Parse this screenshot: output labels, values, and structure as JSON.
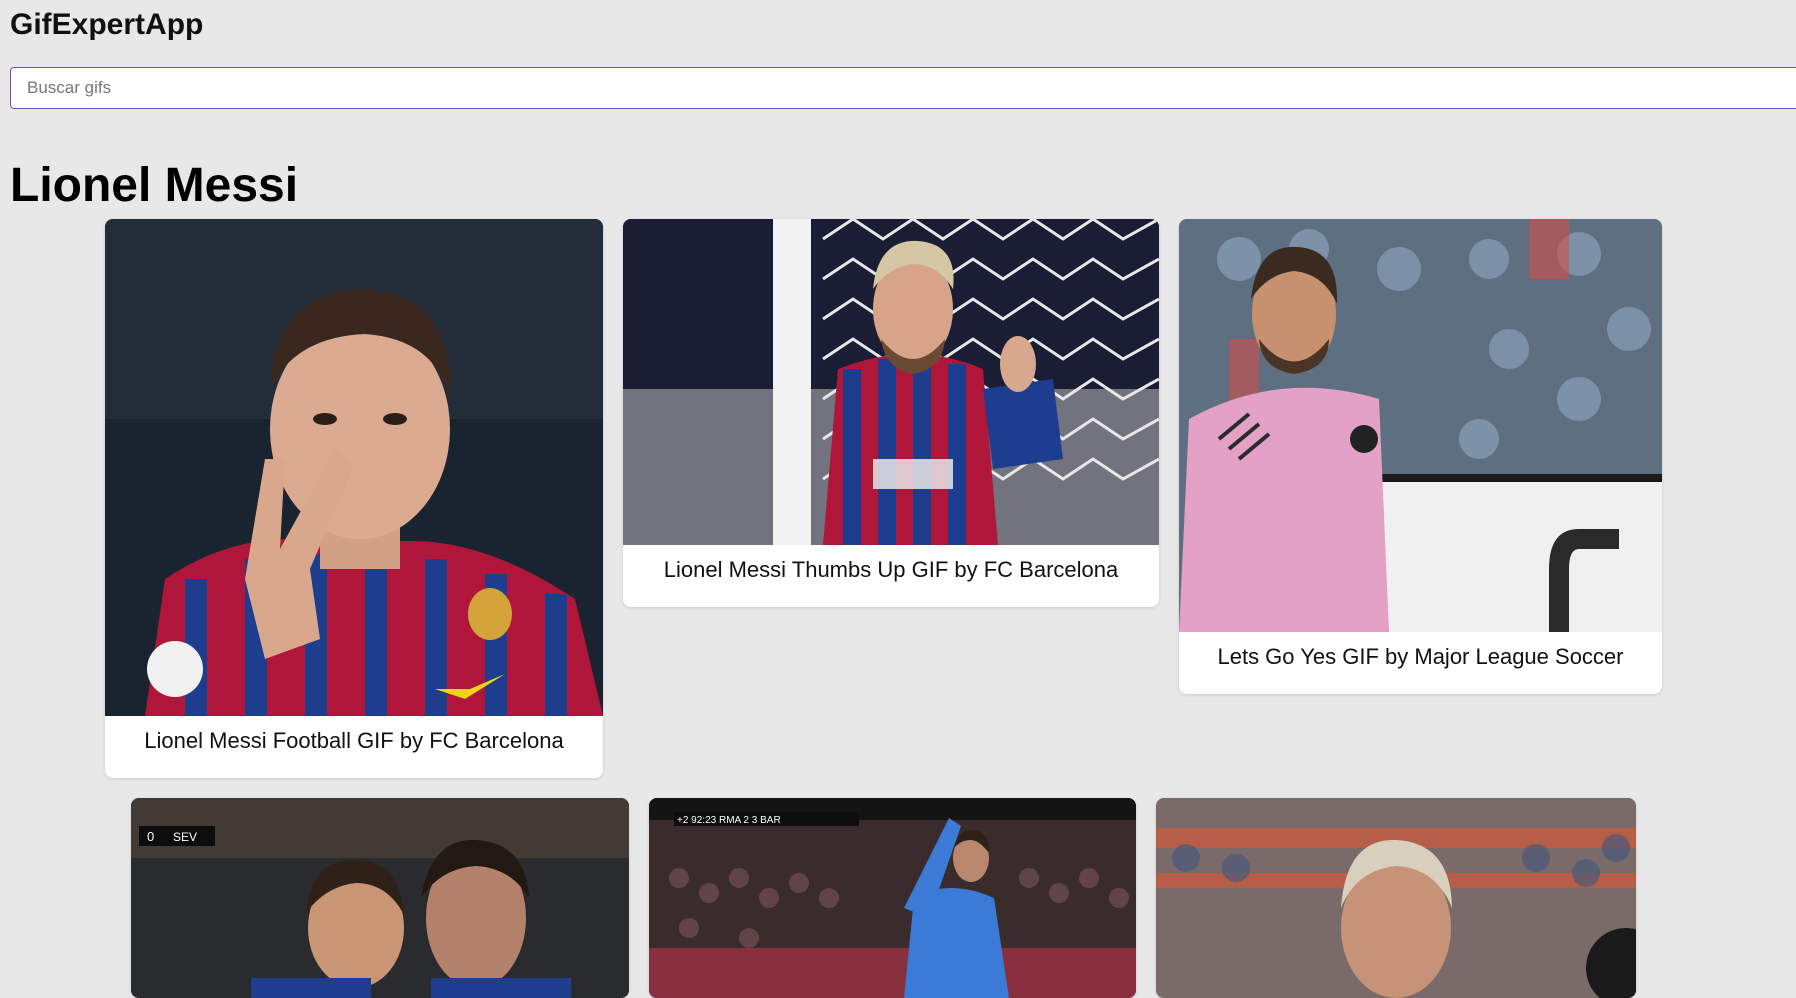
{
  "header": {
    "app_title": "GifExpertApp"
  },
  "search": {
    "placeholder": "Buscar gifs",
    "value": ""
  },
  "category": {
    "title": "Lionel Messi"
  },
  "gifs": [
    {
      "title": "Lionel Messi Football GIF by FC Barcelona"
    },
    {
      "title": "Lionel Messi Thumbs Up GIF by FC Barcelona"
    },
    {
      "title": "Lets Go Yes GIF by Major League Soccer"
    },
    {
      "title": ""
    },
    {
      "title": ""
    },
    {
      "title": ""
    }
  ],
  "gif_overlays": {
    "card4_score": "0",
    "card4_team": "SEV",
    "card5_scorebar": "+2 92:23 RMA 2 3 BAR"
  },
  "colors": {
    "background": "#e8e8e8",
    "input_border": "#7b4fb8",
    "card_bg": "#ffffff",
    "barca_blue": "#1d3e8f",
    "barca_red": "#b0163a",
    "inter_miami_pink": "#e3a1c6"
  }
}
